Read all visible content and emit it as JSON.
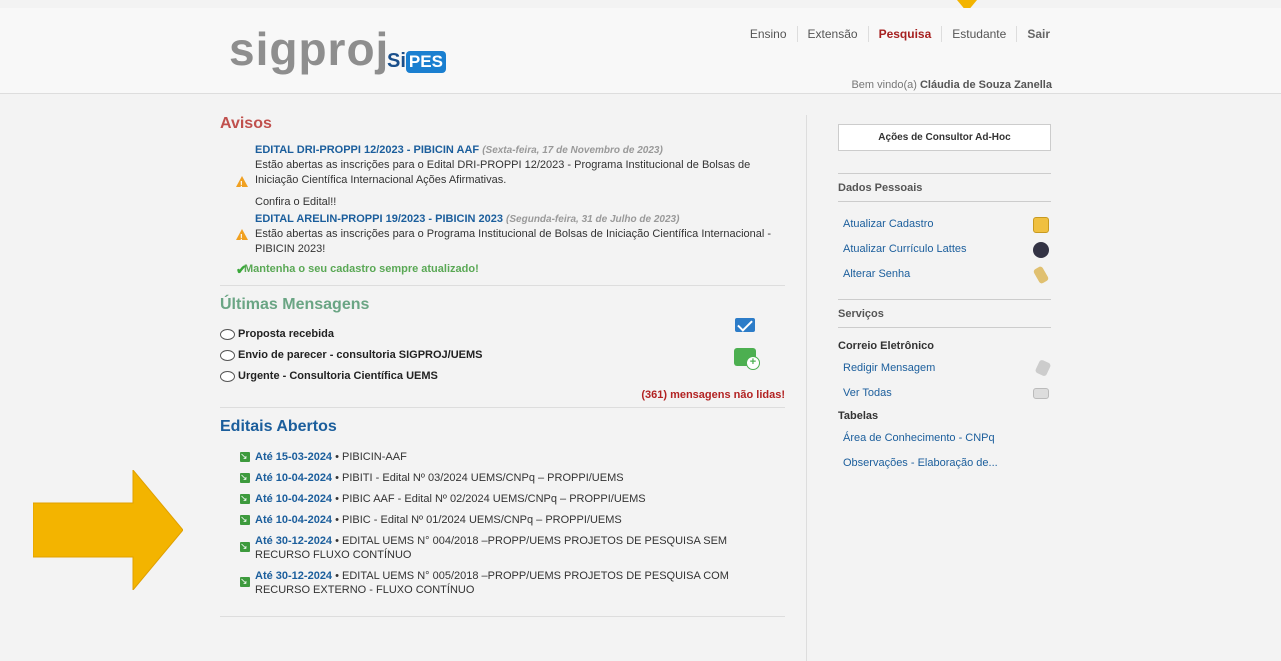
{
  "header": {
    "logo_sig": "sigproj",
    "logo_si": "Si",
    "logo_pes": "PES",
    "nav": [
      {
        "label": "Ensino",
        "active": false
      },
      {
        "label": "Extensão",
        "active": false
      },
      {
        "label": "Pesquisa",
        "active": true
      },
      {
        "label": "Estudante",
        "active": false
      },
      {
        "label": "Sair",
        "active": false
      }
    ],
    "welcome_prefix": "Bem vindo(a)",
    "welcome_name": "Cláudia de Souza Zanella"
  },
  "avisos": {
    "title": "Avisos",
    "items": [
      {
        "title": "EDITAL DRI-PROPPI 12/2023 - PIBICIN AAF",
        "date": "(Sexta-feira, 17 de Novembro de 2023)",
        "text": "Estão abertas as inscrições para o Edital DRI-PROPPI 12/2023 - Programa Institucional de Bolsas de Iniciação Científica Internacional Ações Afirmativas."
      },
      {
        "title": "EDITAL ARELIN-PROPPI 19/2023 - PIBICIN 2023",
        "date": "(Segunda-feira, 31 de Julho de 2023)",
        "text": "Estão abertas as inscrições para o Programa Institucional de Bolsas de Iniciação Científica Internacional - PIBICIN 2023!"
      }
    ],
    "confira": "Confira o Edital!!",
    "keep_updated": "Mantenha o seu cadastro sempre atualizado!"
  },
  "mensagens": {
    "title": "Últimas Mensagens",
    "items": [
      "Proposta recebida",
      "Envio de parecer - consultoria SIGPROJ/UEMS",
      "Urgente - Consultoria Científica UEMS"
    ],
    "unread": "(361) mensagens não lidas!"
  },
  "editais": {
    "title": "Editais Abertos",
    "items": [
      {
        "until": "Até 15-03-2024",
        "text": " • PIBICIN-AAF"
      },
      {
        "until": "Até 10-04-2024",
        "text": " • PIBITI - Edital Nº 03/2024 UEMS/CNPq – PROPPI/UEMS"
      },
      {
        "until": "Até 10-04-2024",
        "text": " • PIBIC AAF - Edital Nº 02/2024 UEMS/CNPq – PROPPI/UEMS"
      },
      {
        "until": "Até 10-04-2024",
        "text": " • PIBIC - Edital Nº 01/2024 UEMS/CNPq – PROPPI/UEMS"
      },
      {
        "until": "Até 30-12-2024",
        "text": " • EDITAL UEMS N° 004/2018 –PROPP/UEMS PROJETOS DE PESQUISA SEM RECURSO FLUXO CONTÍNUO"
      },
      {
        "until": "Até 30-12-2024",
        "text": " • EDITAL UEMS N° 005/2018 –PROPP/UEMS PROJETOS DE PESQUISA COM RECURSO EXTERNO - FLUXO CONTÍNUO"
      }
    ]
  },
  "sidebar": {
    "adhoc_button": "Ações de Consultor Ad-Hoc",
    "dados_pessoais": "Dados Pessoais",
    "dados_links": [
      "Atualizar Cadastro",
      "Atualizar Currículo Lattes",
      "Alterar Senha"
    ],
    "servicos": "Serviços",
    "correio": "Correio Eletrônico",
    "correio_links": [
      "Redigir Mensagem",
      "Ver Todas"
    ],
    "tabelas": "Tabelas",
    "tabelas_links": [
      "Área de Conhecimento - CNPq",
      "Observações - Elaboração de..."
    ]
  },
  "colors": {
    "accent_arrow": "#f3b400",
    "link_blue": "#1b5e9c",
    "avisos_red": "#c0504d",
    "unread_red": "#b22222"
  }
}
